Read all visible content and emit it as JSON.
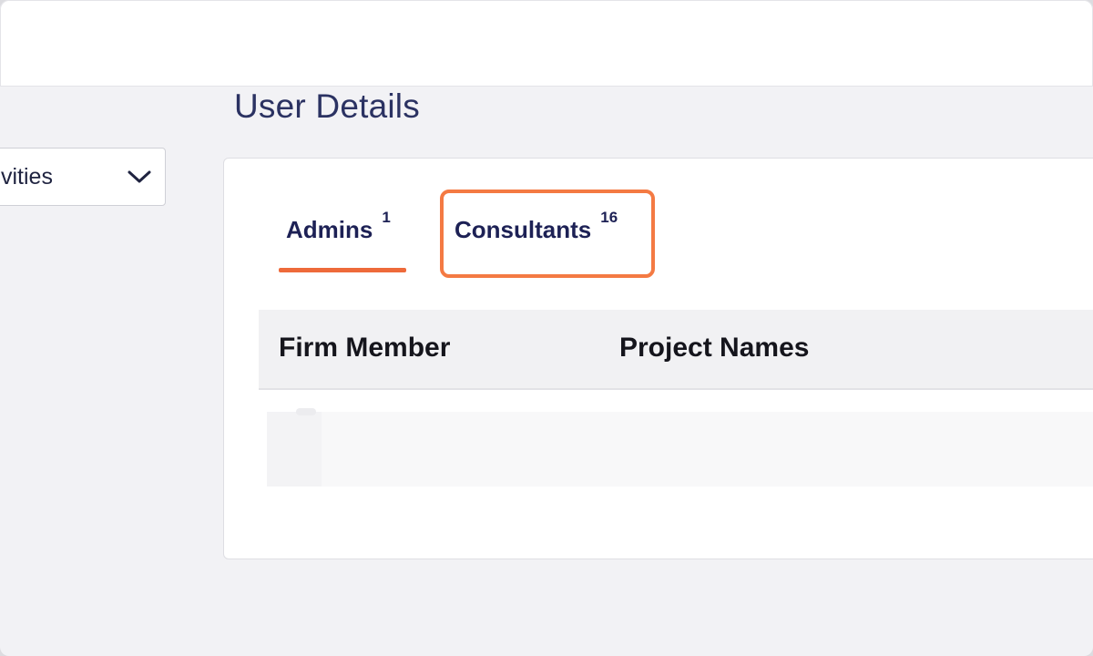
{
  "page": {
    "title": "User Details"
  },
  "filter": {
    "value": "vities"
  },
  "tabs": [
    {
      "label": "Admins",
      "count": "1",
      "active": true
    },
    {
      "label": "Consultants",
      "count": "16",
      "active": false
    }
  ],
  "table": {
    "columns": [
      "Firm Member",
      "Project Names"
    ]
  },
  "colors": {
    "accent": "#ee6a3a",
    "highlight": "#f47a43",
    "tab_text": "#1d2155",
    "title_text": "#2b3262"
  },
  "icons": {
    "filter_chevron": "chevron-down-icon"
  }
}
